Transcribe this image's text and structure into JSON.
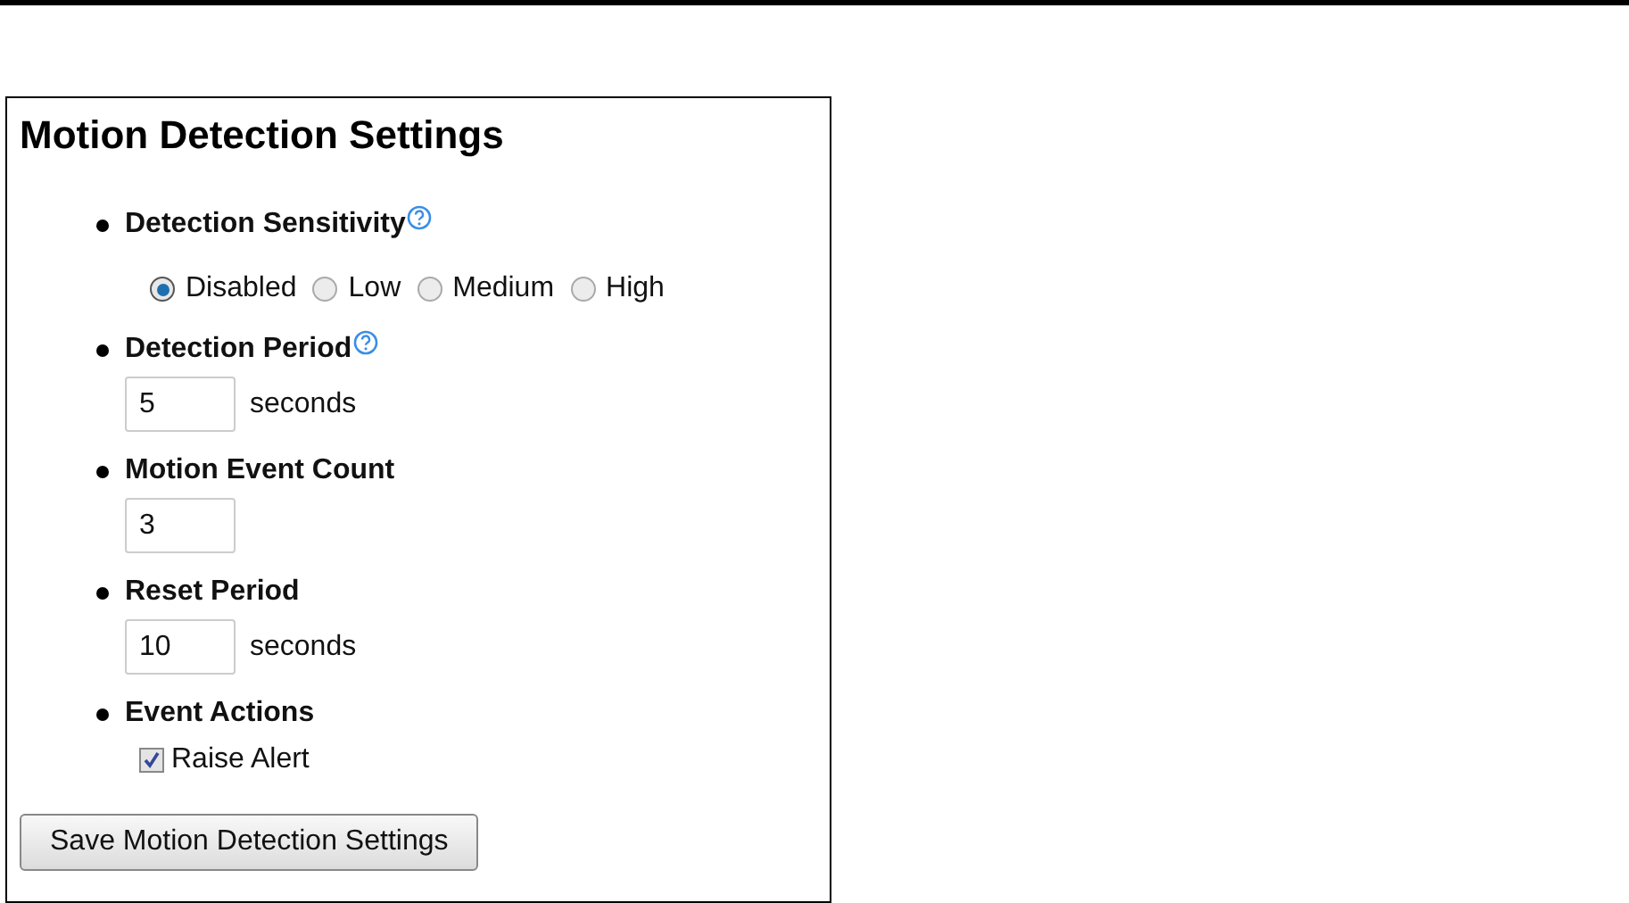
{
  "title": "Motion Detection Settings",
  "settings": [
    {
      "label": "Detection Sensitivity",
      "help": true,
      "kind": "radio",
      "options": [
        {
          "label": "Disabled",
          "selected": true
        },
        {
          "label": "Low",
          "selected": false
        },
        {
          "label": "Medium",
          "selected": false
        },
        {
          "label": "High",
          "selected": false
        }
      ]
    },
    {
      "label": "Detection Period",
      "help": true,
      "kind": "number",
      "value": "5",
      "unit": "seconds"
    },
    {
      "label": "Motion Event Count",
      "help": false,
      "kind": "number",
      "value": "3"
    },
    {
      "label": "Reset Period",
      "help": false,
      "kind": "number",
      "value": "10",
      "unit": "seconds"
    },
    {
      "label": "Event Actions",
      "help": false,
      "kind": "checkbox",
      "options": [
        {
          "label": "Raise Alert",
          "checked": true
        }
      ]
    }
  ],
  "save_button": "Save Motion Detection Settings"
}
